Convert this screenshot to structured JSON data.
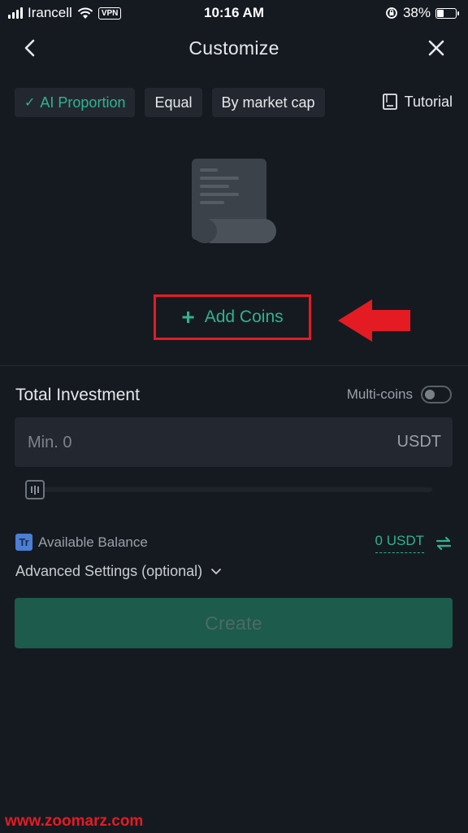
{
  "status_bar": {
    "carrier": "Irancell",
    "vpn": "VPN",
    "time": "10:16 AM",
    "battery": "38%",
    "battery_level": 0.38
  },
  "header": {
    "title": "Customize",
    "back_icon": "chevron-left-icon",
    "close_icon": "close-icon"
  },
  "tabs": [
    {
      "label": "AI Proportion",
      "active": true
    },
    {
      "label": "Equal",
      "active": false
    },
    {
      "label": "By market cap",
      "active": false
    }
  ],
  "tutorial": {
    "label": "Tutorial",
    "icon": "book-icon"
  },
  "add_coins": {
    "label": "Add Coins"
  },
  "investment": {
    "label": "Total Investment",
    "multi_coins_label": "Multi-coins",
    "multi_coins_enabled": false,
    "placeholder": "Min. 0",
    "unit": "USDT",
    "slider_value": 0
  },
  "balance": {
    "label": "Available Balance",
    "icon_text": "Tr",
    "value": "0 USDT"
  },
  "advanced": {
    "label": "Advanced Settings (optional)"
  },
  "create_button": {
    "label": "Create"
  },
  "watermark": "www.zoomarz.com",
  "colors": {
    "background": "#151a21",
    "accent": "#2fb38f",
    "highlight": "#e41b23",
    "button_disabled": "#1d5b4c"
  }
}
